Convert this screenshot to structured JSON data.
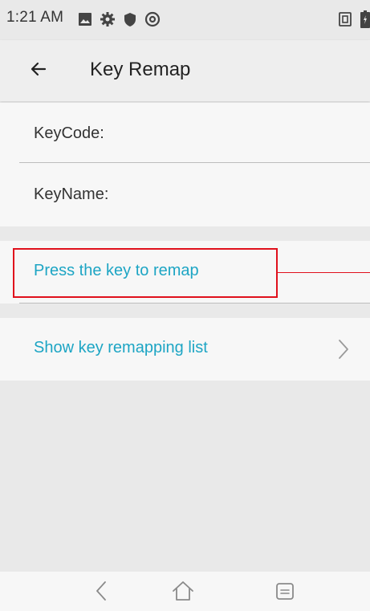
{
  "status_bar": {
    "time": "1:21 AM",
    "left_icons": [
      "image-icon",
      "gear-icon",
      "shield-icon",
      "at-sign-icon"
    ],
    "right_icons": [
      "sim-icon",
      "battery-icon"
    ]
  },
  "app_bar": {
    "title": "Key Remap",
    "back_icon": "arrow-back-icon"
  },
  "key_info": {
    "keycode_label": "KeyCode:",
    "keyname_label": "KeyName:"
  },
  "actions": {
    "press_key": "Press the key to remap",
    "show_list": "Show key remapping list"
  },
  "nav_bar": {
    "icons": [
      "nav-back-icon",
      "nav-home-icon",
      "nav-menu-icon"
    ]
  },
  "colors": {
    "accent": "#1da5c4",
    "highlight": "#e0101c",
    "background": "#e9e9e9",
    "row_background": "#f7f7f7"
  }
}
